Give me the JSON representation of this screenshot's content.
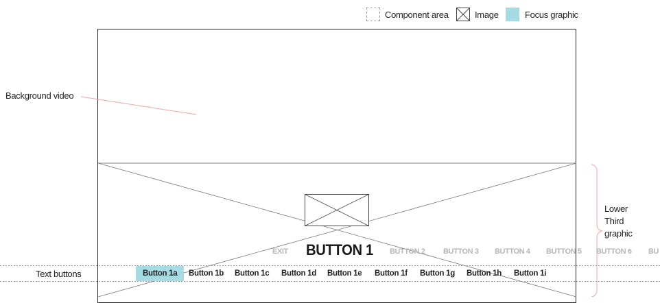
{
  "legend": {
    "component_area": "Component area",
    "image": "Image",
    "focus_graphic": "Focus graphic"
  },
  "colors": {
    "focus": "#a6dbe3",
    "annotation_line": "#f0a6a6",
    "brace": "#f0a6a6"
  },
  "annotations": {
    "background_video": "Background video",
    "lower_third": [
      "Lower",
      "Third",
      "graphic"
    ],
    "text_buttons": "Text buttons"
  },
  "top_row_buttons": [
    {
      "label": "EXIT",
      "state": "dim"
    },
    {
      "label": "BUTTON 1",
      "state": "active"
    },
    {
      "label": "BUTTON 2",
      "state": "dim"
    },
    {
      "label": "BUTTON 3",
      "state": "dim"
    },
    {
      "label": "BUTTON 4",
      "state": "dim"
    },
    {
      "label": "BUTTON 5",
      "state": "dim"
    },
    {
      "label": "BUTTON 6",
      "state": "dim"
    },
    {
      "label": "BU",
      "state": "dim"
    }
  ],
  "sub_buttons": [
    {
      "label": "Button 1a",
      "focused": true
    },
    {
      "label": "Button 1b",
      "focused": false
    },
    {
      "label": "Button 1c",
      "focused": false
    },
    {
      "label": "Button 1d",
      "focused": false
    },
    {
      "label": "Button 1e",
      "focused": false
    },
    {
      "label": "Button 1f",
      "focused": false
    },
    {
      "label": "Button 1g",
      "focused": false
    },
    {
      "label": "Button 1h",
      "focused": false
    },
    {
      "label": "Button 1i",
      "focused": false
    }
  ]
}
